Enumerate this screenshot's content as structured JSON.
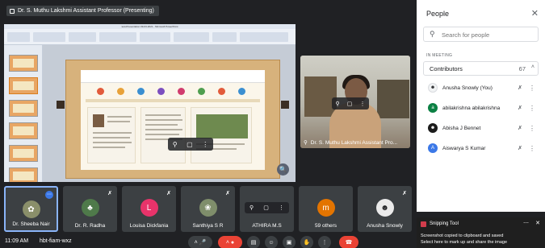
{
  "meeting": {
    "presenter_chip": "Dr. S. Muthu Lakshmi Assistant Professor (Presenting)",
    "time": "11:09 AM",
    "meeting_code": "hbt-fiam-wxz"
  },
  "slide_window": {
    "title_bar": "test-Presentation 09-03-2021 - Microsoft PowerPoint"
  },
  "speaker": {
    "name": "Dr. S. Muthu Lakshmi Assistant Pro..."
  },
  "participants": [
    {
      "name": "Dr. Sheeba Nair",
      "avatar_color": "#8a8f6a",
      "initial": ""
    },
    {
      "name": "Dr. R. Radha",
      "avatar_color": "#4f7a4a",
      "initial": ""
    },
    {
      "name": "Louisa Dickfania",
      "avatar_color": "#e8336a",
      "initial": "L"
    },
    {
      "name": "Santhiya S R",
      "avatar_color": "#7f8e6b",
      "initial": ""
    },
    {
      "name": "ATHIRA M.S",
      "avatar_color": "#66727f",
      "initial": ""
    },
    {
      "name": "59 others",
      "avatar_color": "#e37400",
      "initial": "m"
    },
    {
      "name": "Anusha Snowly",
      "avatar_color": "#eaeaea",
      "initial": ""
    }
  ],
  "people_panel": {
    "title": "People",
    "search_placeholder": "Search for people",
    "section_label": "IN MEETING",
    "contributors_label": "Contributors",
    "contributors_count": "67",
    "people": [
      {
        "name": "Anusha Snowly (You)",
        "avatar_color": "#f1f3f4",
        "initial": ""
      },
      {
        "name": "abilakrishna abilakrishna",
        "avatar_color": "#0b8043",
        "initial": "a"
      },
      {
        "name": "Abisha J Bennet",
        "avatar_color": "#1b1b1b",
        "initial": ""
      },
      {
        "name": "Aiswarya S Kumar",
        "avatar_color": "#3b78e7",
        "initial": "A"
      }
    ]
  },
  "toast": {
    "app": "Snipping Tool",
    "line1": "Screenshot copied to clipboard and saved",
    "line2": "Select here to mark up and share the image"
  },
  "colors": {
    "end_call": "#ea4335",
    "accent": "#8ab4f8"
  }
}
